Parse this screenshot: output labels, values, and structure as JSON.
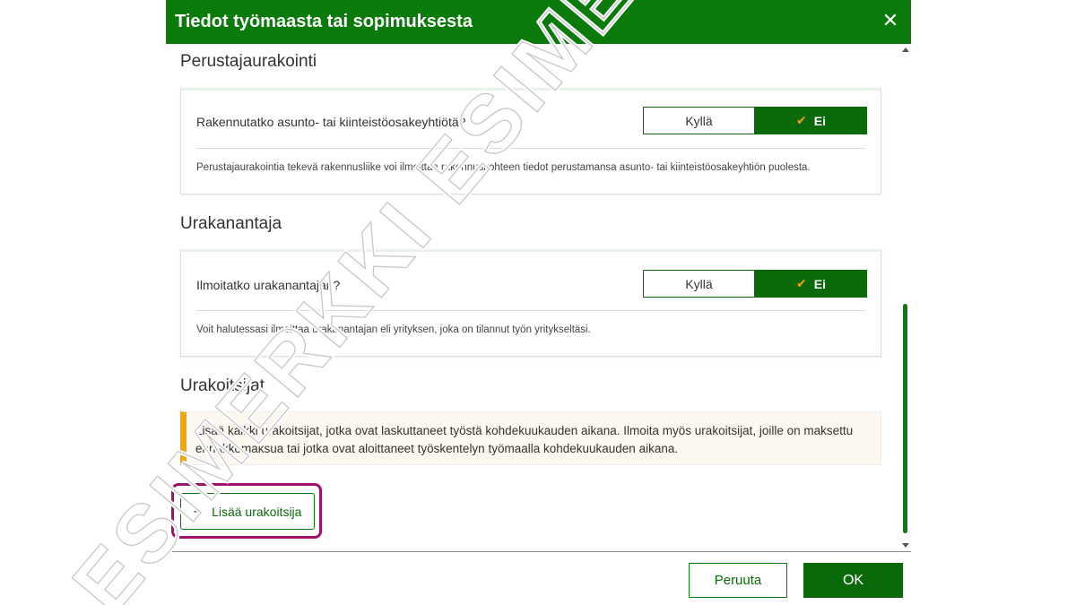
{
  "dialog": {
    "title": "Tiedot työmaasta tai sopimuksesta",
    "close_icon": "close-icon"
  },
  "sections": {
    "founder": {
      "heading": "Perustajaurakointi",
      "question": "Rakennutatko asunto- tai kiinteistöosakeyhtiötä?",
      "yes_label": "Kyllä",
      "no_label": "Ei",
      "selected": "Ei",
      "help": "Perustajaurakointia tekevä rakennusliike voi ilmoittaa rakennuskohteen tiedot perustamansa asunto- tai kiinteistöosakeyhtiön puolesta."
    },
    "client": {
      "heading": "Urakanantaja",
      "question": "Ilmoitatko urakanantajan?",
      "yes_label": "Kyllä",
      "no_label": "Ei",
      "selected": "Ei",
      "help": "Voit halutessasi ilmoittaa urakanantajan eli yrityksen, joka on tilannut työn yritykseltäsi."
    },
    "contractors": {
      "heading": "Urakoitsijat",
      "notice_line1": "Lisää kaikki urakoitsijat, jotka ovat laskuttaneet työstä kohdekuukauden aikana. Ilmoita myös urakoitsijat, joille on maksettu",
      "notice_line2": "ennakkomaksua tai jotka ovat aloittaneet työskentelyn työmaalla kohdekuukauden aikana.",
      "add_label": "Lisää urakoitsija"
    }
  },
  "footer": {
    "cancel_label": "Peruuta",
    "ok_label": "OK"
  },
  "watermark": "ESIMERKKI ESIMERKKI",
  "colors": {
    "primary_green": "#0a7a0a",
    "accent_orange": "#f5a600",
    "highlight_magenta": "#a0126a"
  }
}
